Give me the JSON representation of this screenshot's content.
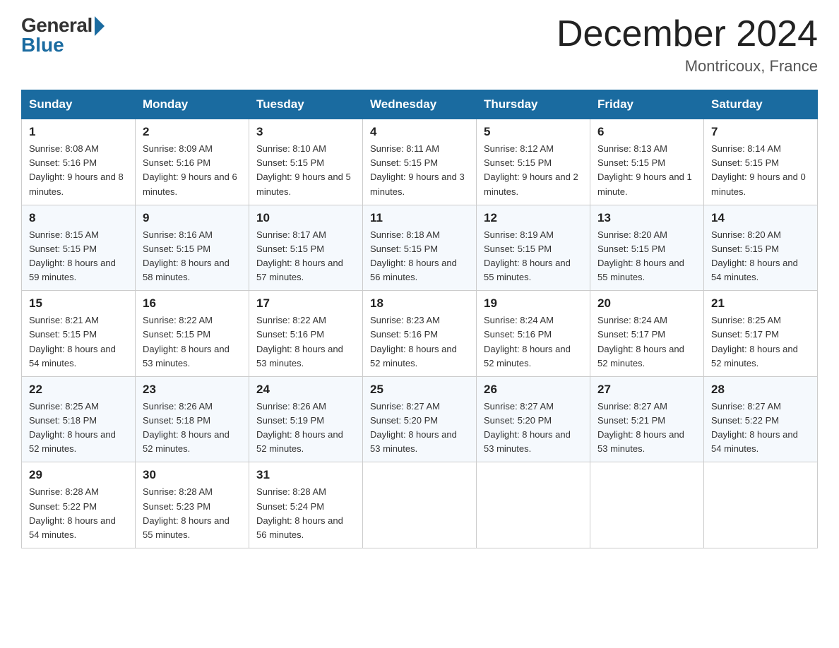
{
  "header": {
    "logo_general": "General",
    "logo_blue": "Blue",
    "month_title": "December 2024",
    "location": "Montricoux, France"
  },
  "weekdays": [
    "Sunday",
    "Monday",
    "Tuesday",
    "Wednesday",
    "Thursday",
    "Friday",
    "Saturday"
  ],
  "weeks": [
    [
      {
        "day": "1",
        "sunrise": "8:08 AM",
        "sunset": "5:16 PM",
        "daylight": "9 hours and 8 minutes."
      },
      {
        "day": "2",
        "sunrise": "8:09 AM",
        "sunset": "5:16 PM",
        "daylight": "9 hours and 6 minutes."
      },
      {
        "day": "3",
        "sunrise": "8:10 AM",
        "sunset": "5:15 PM",
        "daylight": "9 hours and 5 minutes."
      },
      {
        "day": "4",
        "sunrise": "8:11 AM",
        "sunset": "5:15 PM",
        "daylight": "9 hours and 3 minutes."
      },
      {
        "day": "5",
        "sunrise": "8:12 AM",
        "sunset": "5:15 PM",
        "daylight": "9 hours and 2 minutes."
      },
      {
        "day": "6",
        "sunrise": "8:13 AM",
        "sunset": "5:15 PM",
        "daylight": "9 hours and 1 minute."
      },
      {
        "day": "7",
        "sunrise": "8:14 AM",
        "sunset": "5:15 PM",
        "daylight": "9 hours and 0 minutes."
      }
    ],
    [
      {
        "day": "8",
        "sunrise": "8:15 AM",
        "sunset": "5:15 PM",
        "daylight": "8 hours and 59 minutes."
      },
      {
        "day": "9",
        "sunrise": "8:16 AM",
        "sunset": "5:15 PM",
        "daylight": "8 hours and 58 minutes."
      },
      {
        "day": "10",
        "sunrise": "8:17 AM",
        "sunset": "5:15 PM",
        "daylight": "8 hours and 57 minutes."
      },
      {
        "day": "11",
        "sunrise": "8:18 AM",
        "sunset": "5:15 PM",
        "daylight": "8 hours and 56 minutes."
      },
      {
        "day": "12",
        "sunrise": "8:19 AM",
        "sunset": "5:15 PM",
        "daylight": "8 hours and 55 minutes."
      },
      {
        "day": "13",
        "sunrise": "8:20 AM",
        "sunset": "5:15 PM",
        "daylight": "8 hours and 55 minutes."
      },
      {
        "day": "14",
        "sunrise": "8:20 AM",
        "sunset": "5:15 PM",
        "daylight": "8 hours and 54 minutes."
      }
    ],
    [
      {
        "day": "15",
        "sunrise": "8:21 AM",
        "sunset": "5:15 PM",
        "daylight": "8 hours and 54 minutes."
      },
      {
        "day": "16",
        "sunrise": "8:22 AM",
        "sunset": "5:15 PM",
        "daylight": "8 hours and 53 minutes."
      },
      {
        "day": "17",
        "sunrise": "8:22 AM",
        "sunset": "5:16 PM",
        "daylight": "8 hours and 53 minutes."
      },
      {
        "day": "18",
        "sunrise": "8:23 AM",
        "sunset": "5:16 PM",
        "daylight": "8 hours and 52 minutes."
      },
      {
        "day": "19",
        "sunrise": "8:24 AM",
        "sunset": "5:16 PM",
        "daylight": "8 hours and 52 minutes."
      },
      {
        "day": "20",
        "sunrise": "8:24 AM",
        "sunset": "5:17 PM",
        "daylight": "8 hours and 52 minutes."
      },
      {
        "day": "21",
        "sunrise": "8:25 AM",
        "sunset": "5:17 PM",
        "daylight": "8 hours and 52 minutes."
      }
    ],
    [
      {
        "day": "22",
        "sunrise": "8:25 AM",
        "sunset": "5:18 PM",
        "daylight": "8 hours and 52 minutes."
      },
      {
        "day": "23",
        "sunrise": "8:26 AM",
        "sunset": "5:18 PM",
        "daylight": "8 hours and 52 minutes."
      },
      {
        "day": "24",
        "sunrise": "8:26 AM",
        "sunset": "5:19 PM",
        "daylight": "8 hours and 52 minutes."
      },
      {
        "day": "25",
        "sunrise": "8:27 AM",
        "sunset": "5:20 PM",
        "daylight": "8 hours and 53 minutes."
      },
      {
        "day": "26",
        "sunrise": "8:27 AM",
        "sunset": "5:20 PM",
        "daylight": "8 hours and 53 minutes."
      },
      {
        "day": "27",
        "sunrise": "8:27 AM",
        "sunset": "5:21 PM",
        "daylight": "8 hours and 53 minutes."
      },
      {
        "day": "28",
        "sunrise": "8:27 AM",
        "sunset": "5:22 PM",
        "daylight": "8 hours and 54 minutes."
      }
    ],
    [
      {
        "day": "29",
        "sunrise": "8:28 AM",
        "sunset": "5:22 PM",
        "daylight": "8 hours and 54 minutes."
      },
      {
        "day": "30",
        "sunrise": "8:28 AM",
        "sunset": "5:23 PM",
        "daylight": "8 hours and 55 minutes."
      },
      {
        "day": "31",
        "sunrise": "8:28 AM",
        "sunset": "5:24 PM",
        "daylight": "8 hours and 56 minutes."
      },
      null,
      null,
      null,
      null
    ]
  ]
}
